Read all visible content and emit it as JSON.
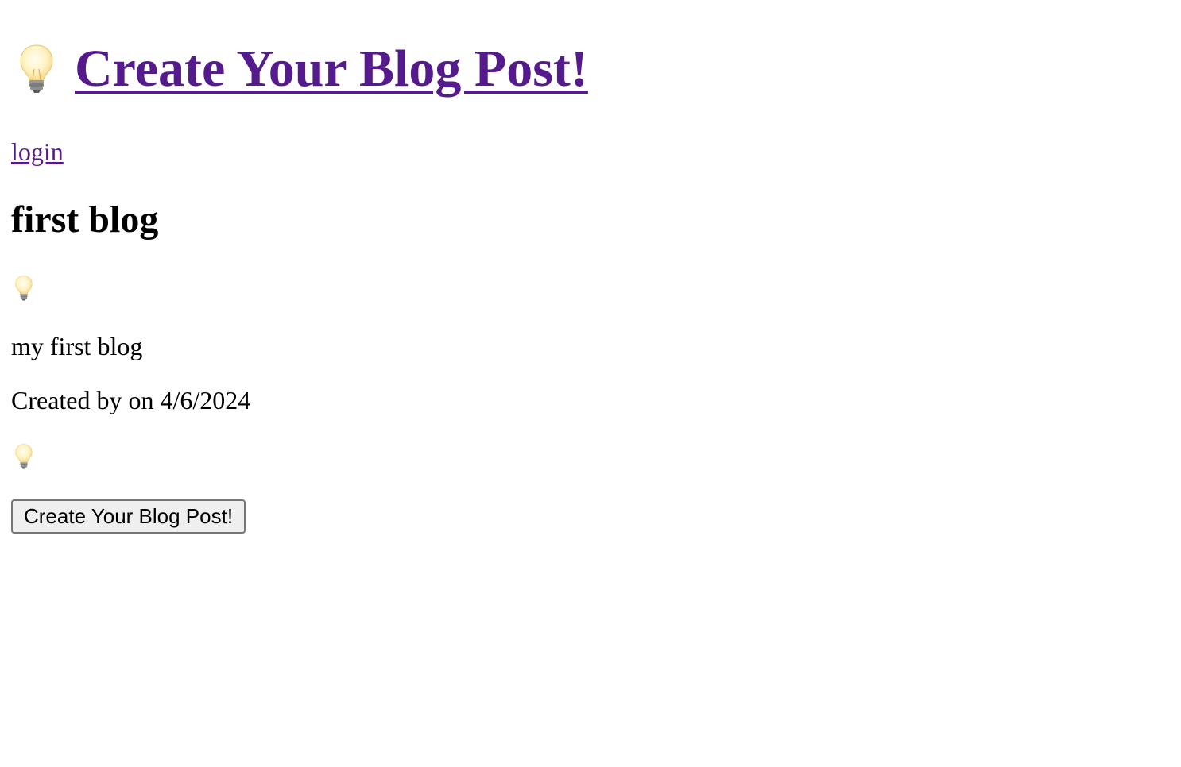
{
  "header": {
    "icon": "lightbulb-icon",
    "title_link": "Create Your Blog Post!"
  },
  "nav": {
    "login_link": "login"
  },
  "post": {
    "title": "first blog",
    "icon": "lightbulb-icon",
    "body": "my first blog",
    "meta": "Created by on 4/6/2024",
    "footer_icon": "lightbulb-icon"
  },
  "actions": {
    "create_button": "Create Your Blog Post!"
  },
  "colors": {
    "link": "#551a8b",
    "button_bg": "#efefef",
    "button_border": "#767676"
  }
}
